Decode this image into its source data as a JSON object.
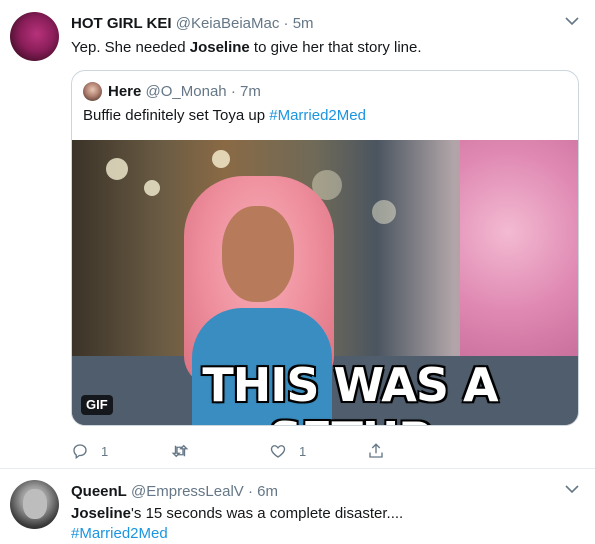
{
  "tweet1": {
    "name": "HOT GIRL KEI",
    "handle": "@KeiaBeiaMac",
    "separator": "·",
    "time": "5m",
    "text_before": "Yep. She needed ",
    "text_bold": "Joseline",
    "text_after": " to give her that story line.",
    "quote": {
      "name": "Here",
      "handle": "@O_Monah",
      "separator": "·",
      "time": "7m",
      "text_before": "Buffie definitely set Toya up ",
      "hashtag": "#Married2Med",
      "gif_caption": "THIS WAS A SETUP",
      "gif_badge": "GIF"
    },
    "actions": {
      "reply_count": "1",
      "retweet_count": "",
      "like_count": "1"
    }
  },
  "tweet2": {
    "name": "QueenL",
    "handle": "@EmpressLealV",
    "separator": "·",
    "time": "6m",
    "text_bold": "Joseline",
    "text_after": "'s 15 seconds was a complete disaster....",
    "hashtag": "#Married2Med"
  },
  "colors": {
    "link": "#1b95e0",
    "secondary": "#657786",
    "border": "#ccd6dd"
  }
}
